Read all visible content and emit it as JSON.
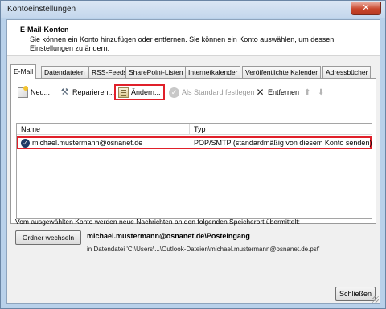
{
  "window": {
    "title": "Kontoeinstellungen",
    "close_glyph": "✕"
  },
  "header": {
    "title": "E-Mail-Konten",
    "description": "Sie können ein Konto hinzufügen oder entfernen. Sie können ein Konto auswählen, um dessen Einstellungen zu ändern."
  },
  "tabs": [
    {
      "label": "E-Mail",
      "active": true
    },
    {
      "label": "Datendateien"
    },
    {
      "label": "RSS-Feeds"
    },
    {
      "label": "SharePoint-Listen"
    },
    {
      "label": "Internetkalender"
    },
    {
      "label": "Veröffentlichte Kalender"
    },
    {
      "label": "Adressbücher"
    }
  ],
  "toolbar": {
    "new_label": "Neu...",
    "repair_label": "Reparieren...",
    "change_label": "Ändern...",
    "set_default_label": "Als Standard festlegen",
    "remove_label": "Entfernen",
    "up_glyph": "⬆",
    "down_glyph": "⬇",
    "repair_glyph": "⚒",
    "default_glyph": "✓",
    "remove_glyph": "✕"
  },
  "account_list": {
    "columns": {
      "name": "Name",
      "type": "Typ"
    },
    "rows": [
      {
        "name": "michael.mustermann@osnanet.de",
        "type": "POP/SMTP (standardmäßig von diesem Konto senden)",
        "default_glyph": "✓",
        "selected": true
      }
    ]
  },
  "delivery": {
    "info": "Vom ausgewählten Konto werden neue Nachrichten an den folgenden Speicherort übermittelt:",
    "change_folder_label": "Ordner wechseln",
    "mailbox_path": "michael.mustermann@osnanet.de\\Posteingang",
    "datafile_path": "in Datendatei 'C:\\Users\\...\\Outlook-Dateien\\michael.mustermann@osnanet.de.pst'"
  },
  "footer": {
    "close_label": "Schließen"
  },
  "colors": {
    "highlight": "#e0202a",
    "title_bar": "#c3d6ec",
    "default_check": "#1f3b66"
  }
}
